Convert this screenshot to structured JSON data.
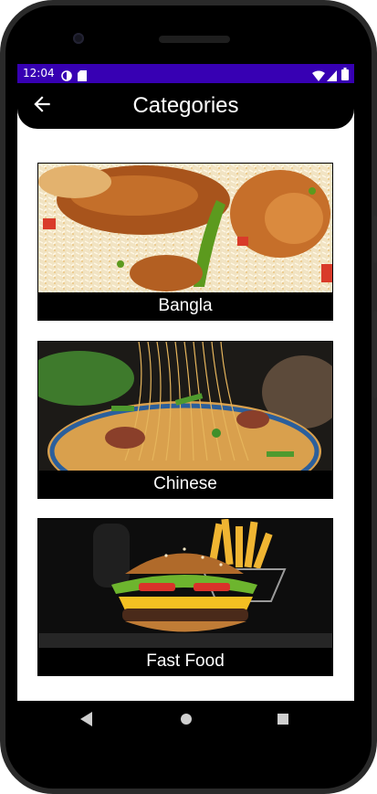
{
  "status_bar": {
    "time": "12:04",
    "background": "#3700b3",
    "icons": [
      "data-saver-icon",
      "sd-card-icon",
      "wifi-icon",
      "signal-icon",
      "battery-icon"
    ]
  },
  "app_bar": {
    "title": "Categories",
    "back_icon": "arrow-left-icon",
    "background": "#000000"
  },
  "categories": [
    {
      "label": "Bangla",
      "image": "chicken-biryani-photo"
    },
    {
      "label": "Chinese",
      "image": "noodles-photo"
    },
    {
      "label": "Fast Food",
      "image": "burger-fries-photo"
    }
  ],
  "nav_bar": {
    "icons": [
      "back-triangle-icon",
      "home-circle-icon",
      "recents-square-icon"
    ]
  }
}
